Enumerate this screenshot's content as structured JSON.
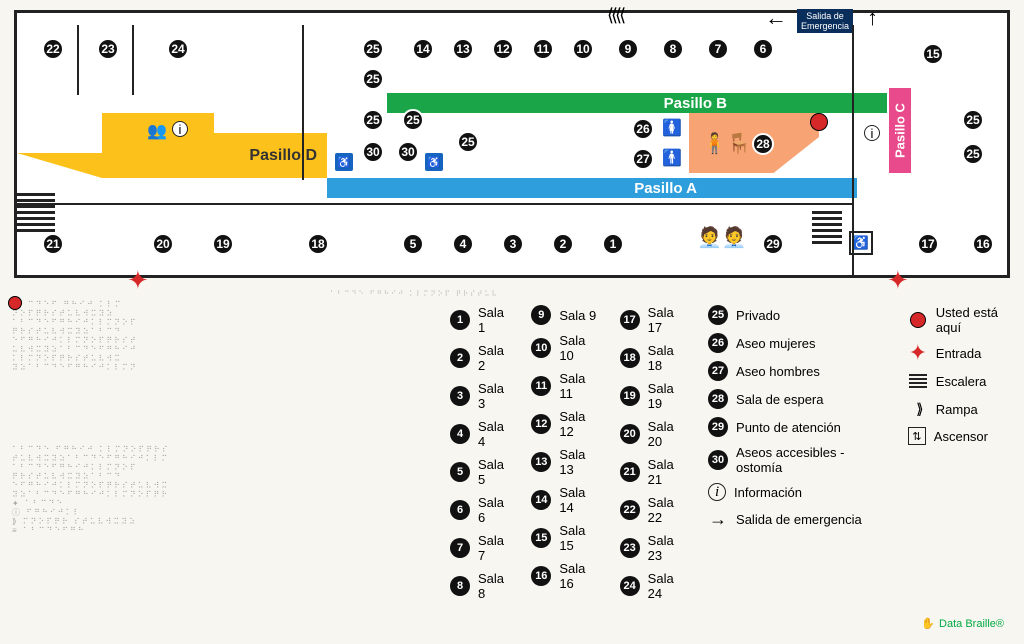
{
  "corridors": {
    "a": "Pasillo A",
    "b": "Pasillo B",
    "c": "Pasillo C",
    "d": "Pasillo D"
  },
  "signs": {
    "emergency_exit": "Salida de\nEmergencia"
  },
  "legend_rooms": [
    {
      "n": "1",
      "label": "Sala 1"
    },
    {
      "n": "2",
      "label": "Sala 2"
    },
    {
      "n": "3",
      "label": "Sala 3"
    },
    {
      "n": "4",
      "label": "Sala 4"
    },
    {
      "n": "5",
      "label": "Sala 5"
    },
    {
      "n": "6",
      "label": "Sala 6"
    },
    {
      "n": "7",
      "label": "Sala 7"
    },
    {
      "n": "8",
      "label": "Sala 8"
    },
    {
      "n": "9",
      "label": "Sala 9"
    },
    {
      "n": "10",
      "label": "Sala 10"
    },
    {
      "n": "11",
      "label": "Sala 11"
    },
    {
      "n": "12",
      "label": "Sala 12"
    },
    {
      "n": "13",
      "label": "Sala 13"
    },
    {
      "n": "14",
      "label": "Sala 14"
    },
    {
      "n": "15",
      "label": "Sala 15"
    },
    {
      "n": "16",
      "label": "Sala 16"
    },
    {
      "n": "17",
      "label": "Sala 17"
    },
    {
      "n": "18",
      "label": "Sala 18"
    },
    {
      "n": "19",
      "label": "Sala 19"
    },
    {
      "n": "20",
      "label": "Sala 20"
    },
    {
      "n": "21",
      "label": "Sala 21"
    },
    {
      "n": "22",
      "label": "Sala 22"
    },
    {
      "n": "23",
      "label": "Sala 23"
    },
    {
      "n": "24",
      "label": "Sala 24"
    }
  ],
  "legend_special": [
    {
      "n": "25",
      "label": "Privado"
    },
    {
      "n": "26",
      "label": "Aseo mujeres"
    },
    {
      "n": "27",
      "label": "Aseo hombres"
    },
    {
      "n": "28",
      "label": "Sala de espera"
    },
    {
      "n": "29",
      "label": "Punto de atención"
    },
    {
      "n": "30",
      "label": "Aseos accesibles - ostomía"
    },
    {
      "n": "i",
      "label": "Información"
    },
    {
      "n": "→",
      "label": "Salida de emergencia"
    }
  ],
  "legend_symbols": [
    {
      "sym": "red-dot",
      "label": "Usted está aquí"
    },
    {
      "sym": "red-star",
      "label": "Entrada"
    },
    {
      "sym": "stairs",
      "label": "Escalera"
    },
    {
      "sym": "ramp",
      "label": "Rampa"
    },
    {
      "sym": "elevator",
      "label": "Ascensor"
    }
  ],
  "brand": "Data Braille®",
  "map_numbers": {
    "row_top": [
      "22",
      "23",
      "24"
    ],
    "row_top_right": [
      "25",
      "14",
      "13",
      "12",
      "11",
      "10",
      "9",
      "8",
      "7",
      "6"
    ],
    "far_right_top": "15",
    "r25a": "25",
    "row_mid_left": [
      "25",
      "25"
    ],
    "row_mid_25c": "25",
    "row_mid_30a": "30",
    "row_mid_30b": "30",
    "n26": "26",
    "n27": "27",
    "n28": "28",
    "right_25a": "25",
    "right_25b": "25",
    "row_bottom": [
      "21",
      "20",
      "19",
      "18",
      "5",
      "4",
      "3",
      "2",
      "1"
    ],
    "n29": "29",
    "n17": "17",
    "n16": "16"
  },
  "icons": {
    "info": "ℹ",
    "woman": "🚺",
    "man": "🚹",
    "wheelchair": "♿",
    "waitingroom": "🧍",
    "meeting": "👥",
    "elevator": "⇅"
  }
}
